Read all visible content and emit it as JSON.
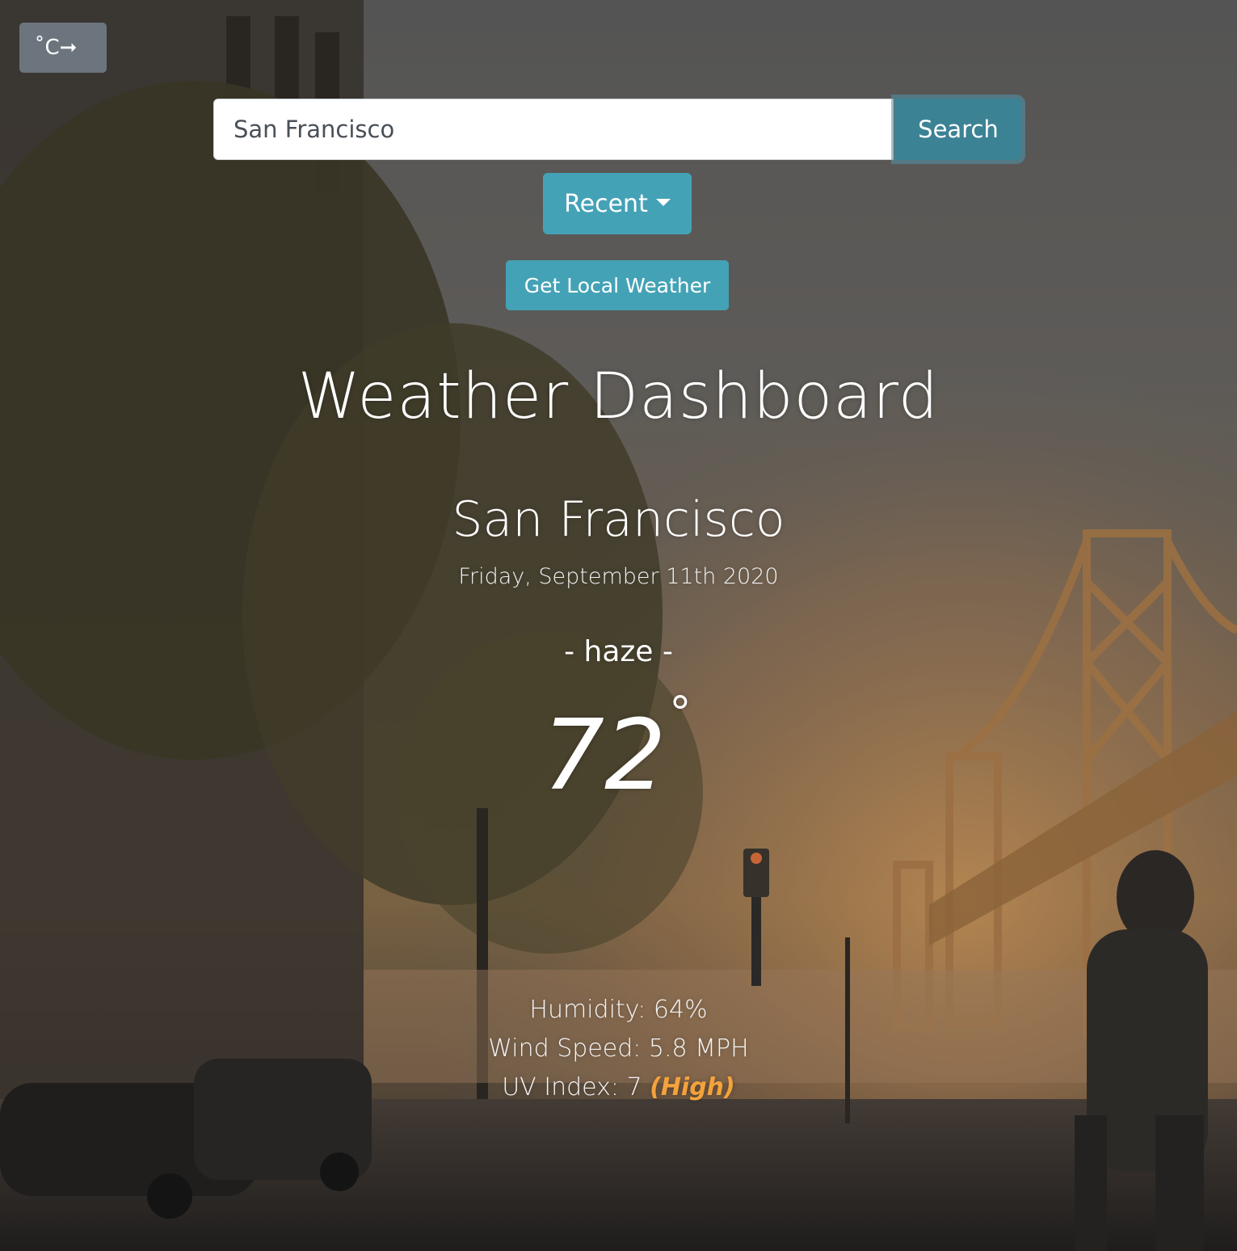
{
  "toggle": {
    "label": "˚C➞",
    "icon": "unit-toggle-arrow"
  },
  "search": {
    "value": "San Francisco",
    "placeholder": "",
    "button_label": "Search"
  },
  "recent": {
    "label": "Recent"
  },
  "local": {
    "label": "Get Local Weather"
  },
  "header": {
    "title": "Weather Dashboard"
  },
  "weather": {
    "city": "San Francisco",
    "date": "Friday, September 11th 2020",
    "condition": "- haze -",
    "temperature": "72",
    "degree": "˚",
    "humidity": "Humidity: 64%",
    "wind": "Wind Speed: 5.8 MPH",
    "uv_prefix": "UV Index: 7",
    "uv_level": "(High)"
  },
  "colors": {
    "accent": "#44a2b6",
    "search_button": "#3c8295",
    "toggle": "#6c757d",
    "uv_high": "#f4a23c"
  }
}
